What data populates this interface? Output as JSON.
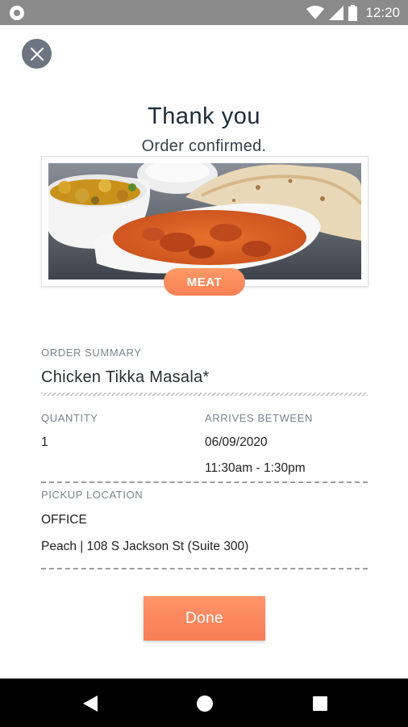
{
  "status_bar": {
    "time": "12:20"
  },
  "header": {
    "title": "Thank you",
    "subtitle": "Order confirmed."
  },
  "image": {
    "category_badge": "MEAT"
  },
  "order_summary": {
    "label": "ORDER SUMMARY",
    "item_name": "Chicken Tikka Masala*",
    "quantity_label": "QUANTITY",
    "quantity": "1",
    "arrives_label": "ARRIVES BETWEEN",
    "arrival_date": "06/09/2020",
    "arrival_time": "11:30am - 1:30pm",
    "pickup_label": "PICKUP LOCATION",
    "pickup_type": "OFFICE",
    "pickup_address": "Peach | 108 S Jackson St (Suite 300)"
  },
  "actions": {
    "done_label": "Done"
  },
  "colors": {
    "accent": "#f78054",
    "close_button": "#6e7582",
    "status_bar": "#8a8a8a"
  },
  "icons": [
    "close-icon",
    "wifi-icon",
    "signal-icon",
    "battery-icon",
    "back-icon",
    "home-icon",
    "recents-icon"
  ]
}
